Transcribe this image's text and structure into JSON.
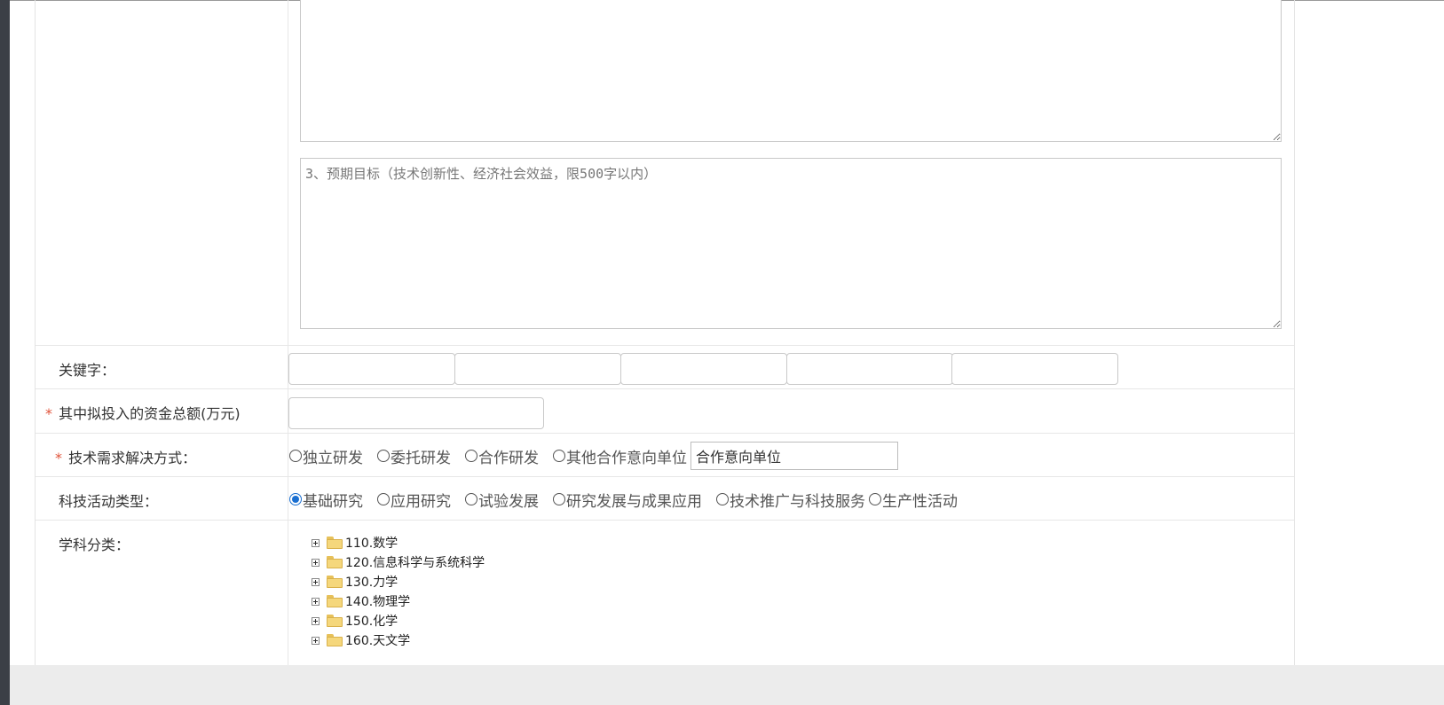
{
  "textarea_goals": {
    "placeholder": "3、预期目标（技术创新性、经济社会效益，限500字以内）"
  },
  "keywords": {
    "label": "关键字："
  },
  "funding": {
    "required_mark": "*",
    "label": "其中拟投入的资金总额(万元)"
  },
  "solution": {
    "required_mark": "*",
    "label": "技术需求解决方式：",
    "options": [
      "独立研发",
      "委托研发",
      "合作研发",
      "其他合作意向单位"
    ],
    "partner_input_value": "合作意向单位"
  },
  "activity": {
    "label": "科技活动类型：",
    "options": [
      "基础研究",
      "应用研究",
      "试验发展",
      "研究发展与成果应用",
      "技术推广与科技服务",
      "生产性活动"
    ],
    "selected": "基础研究"
  },
  "subject": {
    "label": "学科分类：",
    "tree": [
      "110.数学",
      "120.信息科学与系统科学",
      "130.力学",
      "140.物理学",
      "150.化学",
      "160.天文学"
    ]
  },
  "colors": {
    "required": "#e0533a",
    "radio_selected": "#1a6fd1",
    "sidebar": "#3b3f46",
    "bottom_bar": "#ececec"
  }
}
